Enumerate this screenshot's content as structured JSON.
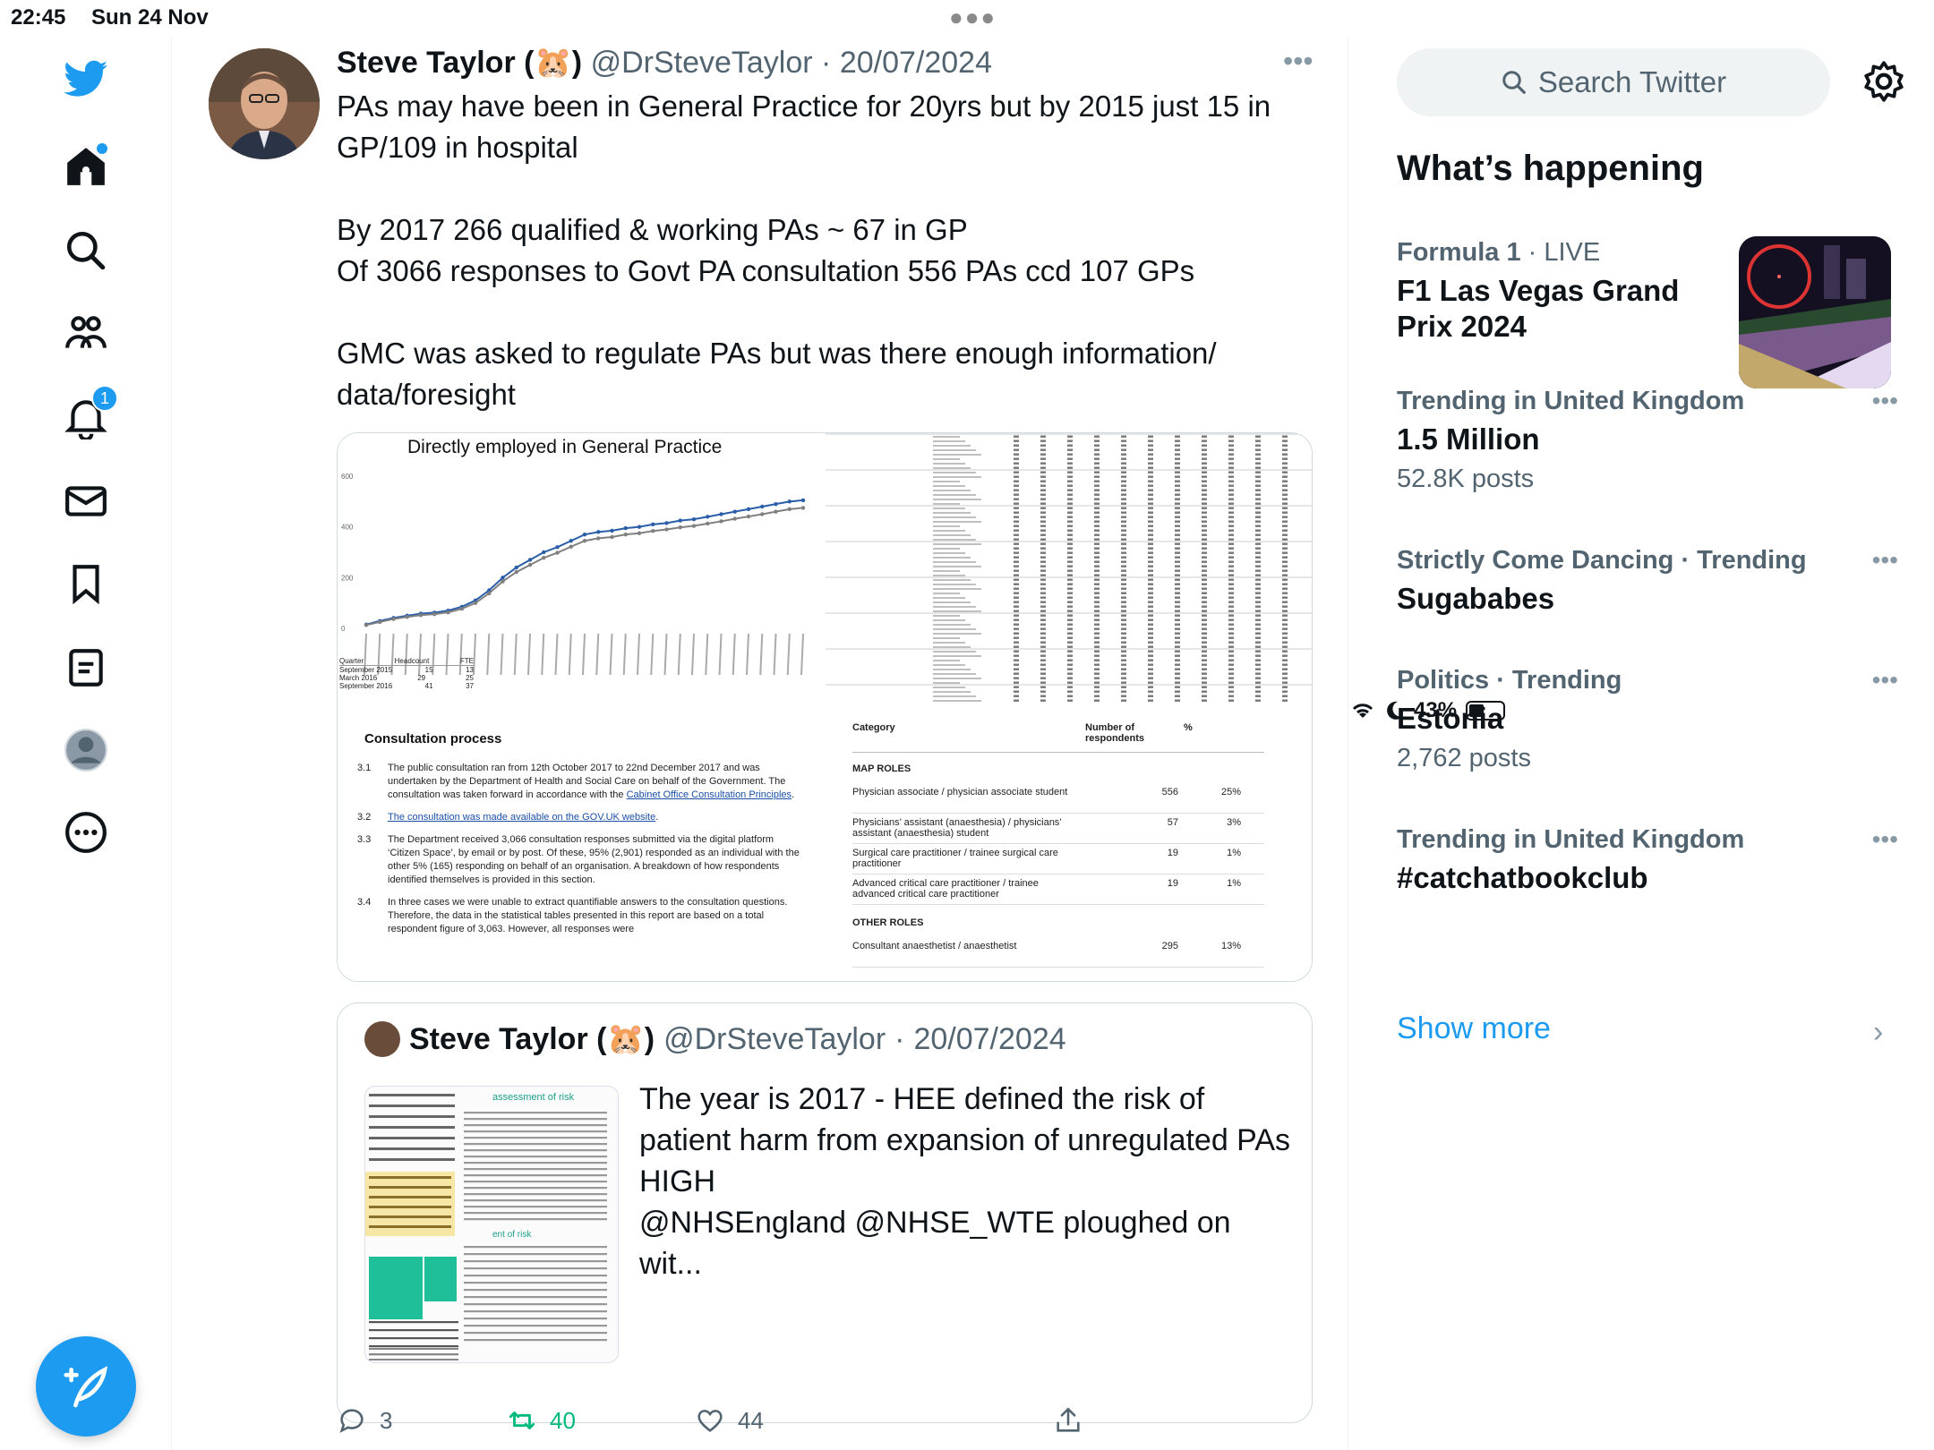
{
  "status_bar": {
    "time": "22:45",
    "date": "Sun 24 Nov",
    "battery_text": "43%",
    "battery_level": 0.43
  },
  "nav": {
    "notifications_badge": "1",
    "compose_label": "Tweet"
  },
  "tweet": {
    "author_name": "Steve Taylor (🐹)",
    "author_handle": "@DrSteveTaylor",
    "separator": "·",
    "date": "20/07/2024",
    "paragraphs": [
      "PAs may have been in General Practice for 20yrs but by 2015 just 15 in GP/109 in hospital",
      "By 2017 266 qualified & working PAs ~ 67 in GP\nOf 3066 responses to Govt PA consultation 556 PAs ccd 107 GPs",
      "GMC was asked to regulate PAs but was there enough information/ data/foresight"
    ],
    "media": {
      "chart_title": "Directly employed in General Practice",
      "chart_y_ticks": [
        "600",
        "400",
        "200",
        "0"
      ],
      "mini_table": {
        "headers": [
          "Quarter",
          "Headcount",
          "FTE"
        ],
        "rows": [
          [
            "September 2015",
            "15",
            "13"
          ],
          [
            "March 2016",
            "29",
            "25"
          ],
          [
            "September 2016",
            "41",
            "37"
          ]
        ]
      },
      "consultation": {
        "heading": "Consultation process",
        "items": [
          {
            "num": "3.1",
            "text": "The public consultation ran from 12th October 2017 to 22nd December 2017 and was undertaken by the Department of Health and Social Care on behalf of the Government. The consultation was taken forward in accordance with the ",
            "link": "Cabinet Office Consultation Principles",
            "tail": "."
          },
          {
            "num": "3.2",
            "text": "",
            "link": "The consultation was made available on the GOV.UK website",
            "tail": "."
          },
          {
            "num": "3.3",
            "text": "The Department received 3,066 consultation responses submitted via the digital platform ‘Citizen Space’, by email or by post. Of these, 95% (2,901) responded as an individual with the other 5% (165) responding on behalf of an organisation. A breakdown of how respondents identified themselves is provided in this section.",
            "link": "",
            "tail": ""
          },
          {
            "num": "3.4",
            "text": "In three cases we were unable to extract quantifiable answers to the consultation questions. Therefore, the data in the statistical tables presented in this report are based on a total respondent figure of 3,063. However, all responses were",
            "link": "",
            "tail": ""
          }
        ]
      },
      "roles_table": {
        "headers": [
          "Category",
          "Number of respondents",
          "%"
        ],
        "section1": "MAP ROLES",
        "rows": [
          [
            "Physician associate / physician associate student",
            "556",
            "25%"
          ],
          [
            "Physicians’ assistant (anaesthesia) / physicians’ assistant (anaesthesia) student",
            "57",
            "3%"
          ],
          [
            "Surgical care practitioner / trainee surgical care practitioner",
            "19",
            "1%"
          ],
          [
            "Advanced critical care practitioner / trainee advanced critical care practitioner",
            "19",
            "1%"
          ]
        ],
        "section2": "OTHER ROLES",
        "rows2": [
          [
            "Consultant anaesthetist / anaesthetist",
            "295",
            "13%"
          ]
        ]
      }
    },
    "quoted": {
      "author_name": "Steve Taylor (🐹)",
      "author_handle": "@DrSteveTaylor",
      "separator": "·",
      "date": "20/07/2024",
      "text": "The year is 2017 - HEE defined the risk of patient harm from expansion of unregulated PAs HIGH\n@NHSEngland @NHSE_WTE ploughed on wit...",
      "image_heading": "assessment of risk",
      "image_heading2": "ent of risk"
    },
    "actions": {
      "replies": "3",
      "retweets": "40",
      "likes": "44"
    }
  },
  "sidebar": {
    "search_placeholder": "Search Twitter",
    "heading": "What’s happening",
    "trends": [
      {
        "context": "Formula 1",
        "sep": " · ",
        "context2": "LIVE",
        "title": "F1 Las Vegas Grand Prix 2024",
        "count": ""
      },
      {
        "context": "Trending in United Kingdom",
        "sep": "",
        "context2": "",
        "title": "1.5 Million",
        "count": "52.8K posts"
      },
      {
        "context": "Strictly Come Dancing · Trending",
        "sep": "",
        "context2": "",
        "title": "Sugababes",
        "count": ""
      },
      {
        "context": "Politics · Trending",
        "sep": "",
        "context2": "",
        "title": "Estonia",
        "count": "2,762 posts"
      },
      {
        "context": "Trending in United Kingdom",
        "sep": "",
        "context2": "",
        "title": "#catchatbookclub",
        "count": ""
      }
    ],
    "show_more": "Show more"
  },
  "colors": {
    "accent": "#1d9bf0",
    "retweet": "#00ba7c",
    "muted": "#536471"
  },
  "chart_data": {
    "type": "line",
    "title": "Directly employed in General Practice",
    "ylim": [
      0,
      600
    ],
    "series": [
      {
        "values": [
          15,
          29,
          41,
          50,
          58,
          62,
          70,
          85,
          110,
          150,
          200,
          240,
          270,
          300,
          320,
          345,
          370,
          380,
          385,
          395,
          400,
          410,
          415,
          425,
          430,
          440,
          450,
          460,
          470,
          480,
          490,
          500,
          505
        ]
      },
      {
        "values": [
          13,
          25,
          37,
          45,
          52,
          56,
          63,
          77,
          100,
          138,
          185,
          222,
          250,
          278,
          298,
          322,
          345,
          355,
          360,
          370,
          375,
          384,
          390,
          398,
          404,
          413,
          422,
          432,
          441,
          450,
          460,
          470,
          475
        ]
      }
    ]
  }
}
